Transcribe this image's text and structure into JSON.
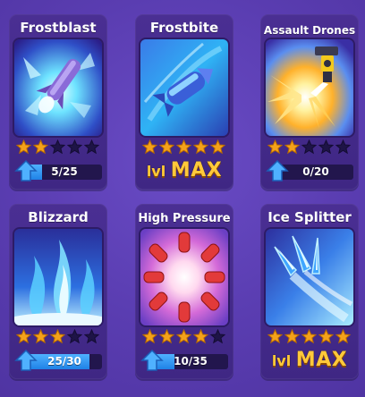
{
  "colors": {
    "star_filled": "#f4a21b",
    "star_empty": "#1e1447",
    "progress_fill": "#2f95f0",
    "max_text": "#ffc93a"
  },
  "cards": [
    {
      "id": "frostblast",
      "title": "Frostblast",
      "icon": "frost-rocket-icon",
      "stars_filled": 2,
      "stars_total": 5,
      "progress_text": "5/25",
      "progress_fraction": 0.2
    },
    {
      "id": "frostbite",
      "title": "Frostbite",
      "icon": "frost-missile-icon",
      "stars_filled": 5,
      "stars_total": 5,
      "max_lvl": "lvl",
      "max_text": "MAX"
    },
    {
      "id": "assault-drones",
      "title": "Assault Drones",
      "icon": "drone-turret-icon",
      "stars_filled": 2,
      "stars_total": 5,
      "progress_text": "0/20",
      "progress_fraction": 0.0
    },
    {
      "id": "blizzard",
      "title": "Blizzard",
      "icon": "blue-flames-icon",
      "stars_filled": 3,
      "stars_total": 5,
      "progress_text": "25/30",
      "progress_fraction": 0.833
    },
    {
      "id": "high-pressure",
      "title": "High Pressure",
      "icon": "bullet-burst-icon",
      "stars_filled": 4,
      "stars_total": 5,
      "progress_text": "10/35",
      "progress_fraction": 0.286
    },
    {
      "id": "ice-splitter",
      "title": "Ice Splitter",
      "icon": "ice-shards-icon",
      "stars_filled": 5,
      "stars_total": 5,
      "max_lvl": "lvl",
      "max_text": "MAX"
    }
  ]
}
